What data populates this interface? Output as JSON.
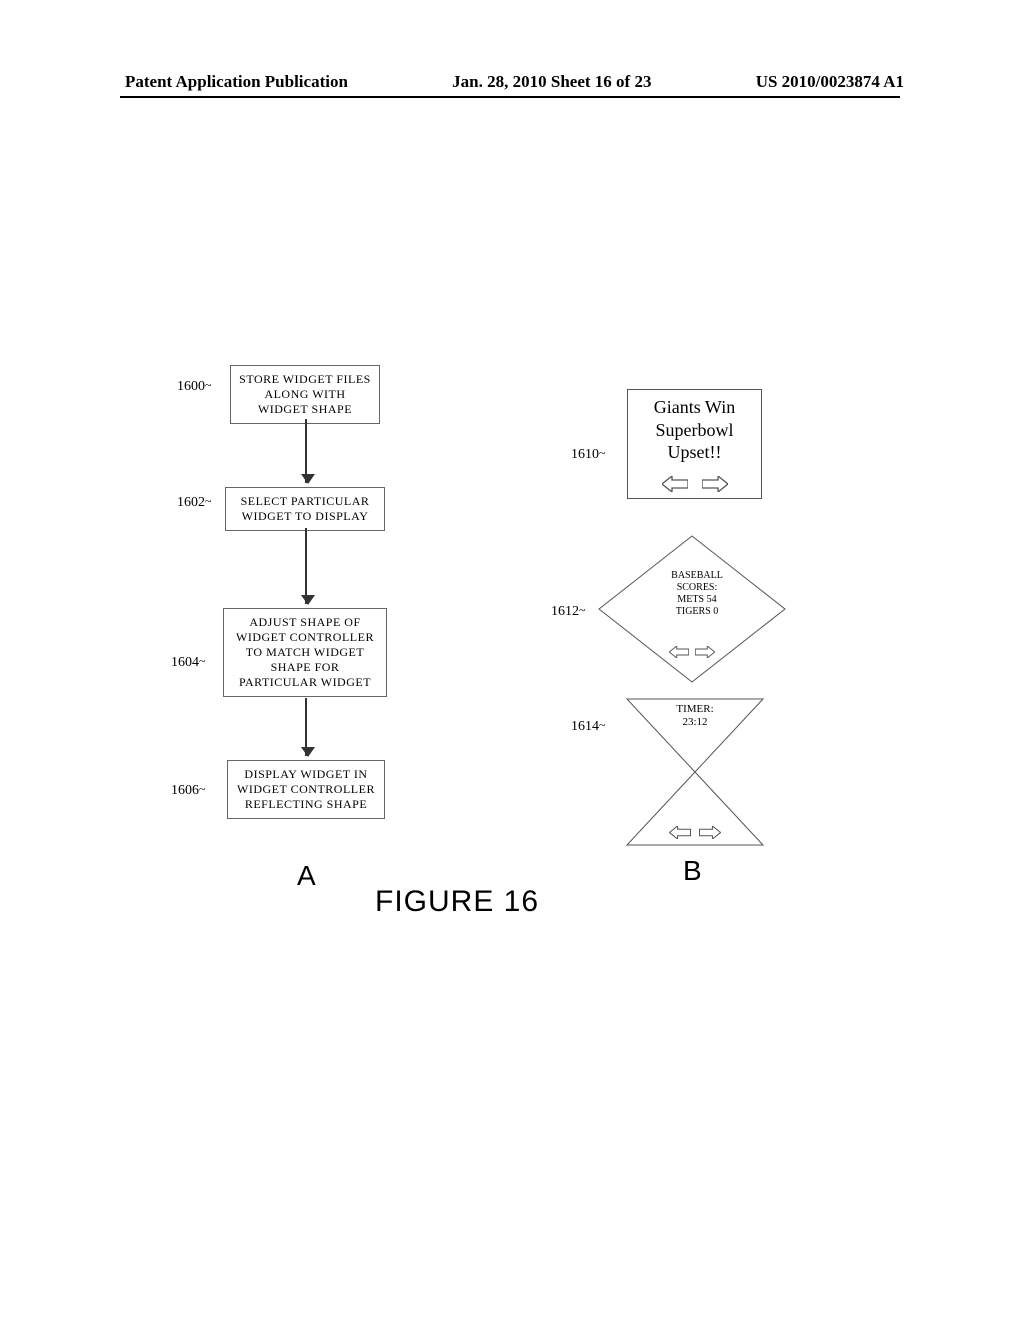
{
  "header": {
    "left": "Patent Application Publication",
    "center": "Jan. 28, 2010  Sheet 16 of 23",
    "right": "US 2010/0023874 A1"
  },
  "flowchart": {
    "b1600": {
      "ref": "1600",
      "text": "STORE WIDGET FILES ALONG WITH WIDGET SHAPE"
    },
    "b1602": {
      "ref": "1602",
      "text": "SELECT PARTICULAR WIDGET TO DISPLAY"
    },
    "b1604": {
      "ref": "1604",
      "text": "ADJUST SHAPE OF WIDGET CONTROLLER TO MATCH WIDGET SHAPE FOR PARTICULAR WIDGET"
    },
    "b1606": {
      "ref": "1606",
      "text": "DISPLAY WIDGET IN WIDGET CONTROLLER REFLECTING SHAPE"
    },
    "label": "A"
  },
  "widgets": {
    "w1610": {
      "ref": "1610",
      "line1": "Giants Win",
      "line2": "Superbowl",
      "line3": "Upset!!"
    },
    "w1612": {
      "ref": "1612",
      "line1": "BASEBALL",
      "line2": "SCORES:",
      "line3": "METS 54",
      "line4": "TIGERS 0"
    },
    "w1614": {
      "ref": "1614",
      "line1": "TIMER:",
      "line2": "23:12"
    },
    "label": "B"
  },
  "figure_label": "FIGURE 16"
}
